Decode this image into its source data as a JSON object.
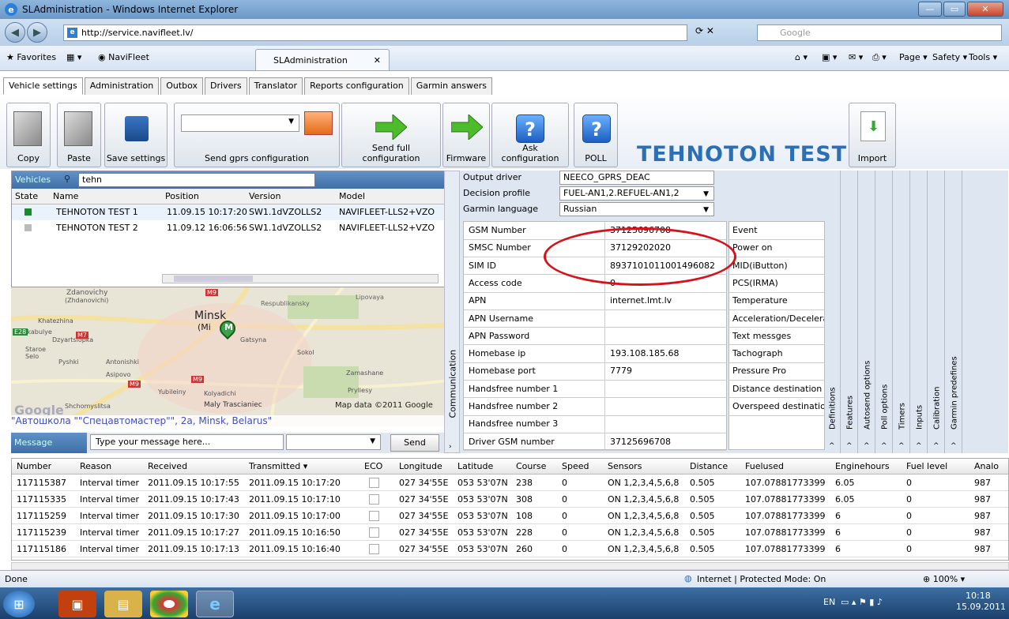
{
  "window": {
    "title": "SLAdministration - Windows Internet Explorer"
  },
  "browser": {
    "url": "http://service.navifleet.lv/",
    "search_placeholder": "Google",
    "favorites_label": "Favorites",
    "fav_site": "NaviFleet",
    "tab_label": "SLAdministration",
    "menu": {
      "page": "Page",
      "safety": "Safety",
      "tools": "Tools"
    }
  },
  "app": {
    "tabs": [
      "Vehicle settings",
      "Administration",
      "Outbox",
      "Drivers",
      "Translator",
      "Reports configuration",
      "Garmin answers"
    ],
    "toolbar": {
      "copy": "Copy",
      "paste": "Paste",
      "save": "Save settings",
      "send_gprs": "Send gprs configuration",
      "send_full": "Send full configuration",
      "firmware": "Firmware",
      "ask_config": "Ask configuration",
      "poll": "POLL",
      "import": "Import"
    },
    "vehicle_title": "TEHNOTON TEST 1"
  },
  "vehicles": {
    "label": "Vehicles",
    "filter": "tehn",
    "columns": [
      "State",
      "Name",
      "Position",
      "Version",
      "Model"
    ],
    "rows": [
      {
        "state": "active",
        "name": "TEHNOTON TEST 1",
        "position": "11.09.15 10:17:20",
        "version": "SW1.1dVZOLLS2",
        "model": "NAVIFLEET-LLS2+VZO"
      },
      {
        "state": "inactive",
        "name": "TEHNOTON TEST 2",
        "position": "11.09.12 16:06:56",
        "version": "SW1.1dVZOLLS2",
        "model": "NAVIFLEET-LLS2+VZO"
      }
    ]
  },
  "map": {
    "city": "Minsk",
    "city_sub": "(Mi",
    "labels": [
      "Zdanovichy",
      "(Zhdanovichi)",
      "Respublikansky",
      "Lipovaya",
      "Khatezhina",
      "Zakabulye",
      "Dzyartsiopka",
      "Staroe Selo",
      "Pyshki",
      "Antonishki",
      "Asipovo",
      "Yubileiny",
      "Kolyadichi",
      "Maly Trascianiec",
      "Zamashane",
      "Pryliesy",
      "Shchomyslitsa",
      "Gatsyna",
      "Sokol"
    ],
    "highway": [
      "E28",
      "M7",
      "M9",
      "M9",
      "M9"
    ],
    "copyright": "Map data ©2011 Google",
    "logo": "Google",
    "address": "\"Автошкола \"\"Спецавтомастер\"\", 2a, Minsk, Belarus\""
  },
  "message": {
    "label": "Message",
    "placeholder": "Type your message here...",
    "send": "Send"
  },
  "communication": {
    "tab_label": "Communication",
    "output_driver_label": "Output driver",
    "output_driver": "NEECO_GPRS_DEAC",
    "decision_profile_label": "Decision profile",
    "decision_profile": "FUEL-AN1,2.REFUEL-AN1,2",
    "garmin_language_label": "Garmin language",
    "garmin_language": "Russian",
    "params": [
      {
        "k": "GSM Number",
        "v": "37125696708"
      },
      {
        "k": "SMSC Number",
        "v": "37129202020"
      },
      {
        "k": "SIM ID",
        "v": "8937101011001496082"
      },
      {
        "k": "Access code",
        "v": "0"
      },
      {
        "k": "APN",
        "v": "internet.lmt.lv"
      },
      {
        "k": "APN Username",
        "v": ""
      },
      {
        "k": "APN Password",
        "v": ""
      },
      {
        "k": "Homebase ip",
        "v": "193.108.185.68"
      },
      {
        "k": "Homebase port",
        "v": "7779"
      },
      {
        "k": "Handsfree number 1",
        "v": ""
      },
      {
        "k": "Handsfree number 2",
        "v": ""
      },
      {
        "k": "Handsfree number 3",
        "v": ""
      },
      {
        "k": "Driver GSM number",
        "v": "37125696708"
      }
    ],
    "events": [
      "Event",
      "Power on",
      "MID(iButton)",
      "PCS(IRMA)",
      "Temperature",
      "Acceleration/Decelera",
      "Text messges",
      "Tachograph",
      "Pressure Pro",
      "Distance destination",
      "Overspeed destinatio"
    ]
  },
  "side_tabs": [
    "Definitions",
    "Features",
    "Autosend options",
    "Poll options",
    "Timers",
    "Inputs",
    "Calibration",
    "Garmin predefines"
  ],
  "grid": {
    "columns": [
      "Number",
      "Reason",
      "Received",
      "Transmitted ▾",
      "ECO",
      "Longitude",
      "Latitude",
      "Course",
      "Speed",
      "Sensors",
      "Distance",
      "Fuelused",
      "Enginehours",
      "Fuel level",
      "Analo"
    ],
    "rows": [
      [
        "117115387",
        "Interval timer",
        "2011.09.15 10:17:55",
        "2011.09.15 10:17:20",
        "",
        "027 34'55E",
        "053 53'07N",
        "238",
        "0",
        "ON 1,2,3,4,5,6,8",
        "0.505",
        "107.07881773399",
        "6.05",
        "0",
        "987"
      ],
      [
        "117115335",
        "Interval timer",
        "2011.09.15 10:17:43",
        "2011.09.15 10:17:10",
        "",
        "027 34'55E",
        "053 53'07N",
        "308",
        "0",
        "ON 1,2,3,4,5,6,8",
        "0.505",
        "107.07881773399",
        "6.05",
        "0",
        "987"
      ],
      [
        "117115259",
        "Interval timer",
        "2011.09.15 10:17:30",
        "2011.09.15 10:17:00",
        "",
        "027 34'55E",
        "053 53'07N",
        "108",
        "0",
        "ON 1,2,3,4,5,6,8",
        "0.505",
        "107.07881773399",
        "6",
        "0",
        "987"
      ],
      [
        "117115239",
        "Interval timer",
        "2011.09.15 10:17:27",
        "2011.09.15 10:16:50",
        "",
        "027 34'55E",
        "053 53'07N",
        "228",
        "0",
        "ON 1,2,3,4,5,6,8",
        "0.505",
        "107.07881773399",
        "6",
        "0",
        "987"
      ],
      [
        "117115186",
        "Interval timer",
        "2011.09.15 10:17:13",
        "2011.09.15 10:16:40",
        "",
        "027 34'55E",
        "053 53'07N",
        "260",
        "0",
        "ON 1,2,3,4,5,6,8",
        "0.505",
        "107.07881773399",
        "6",
        "0",
        "987"
      ]
    ]
  },
  "status": {
    "left": "Done",
    "zone": "Internet | Protected Mode: On",
    "zoom": "100%"
  },
  "taskbar": {
    "lang": "EN",
    "time": "10:18",
    "date": "15.09.2011"
  },
  "colors": {
    "accent": "#2b6fb5",
    "highlight_oval": "#d6121a",
    "header_blue": "#3f6fa6"
  }
}
